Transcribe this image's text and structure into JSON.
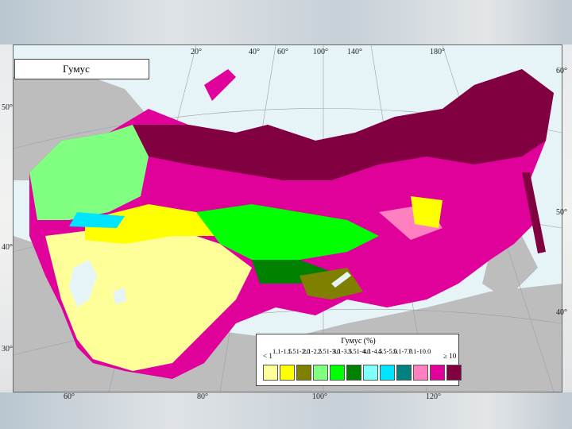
{
  "map": {
    "title": "Гумус",
    "top_ticks": [
      "20°",
      "40°",
      "60°",
      "100°",
      "140°",
      "180°"
    ],
    "bottom_ticks": [
      "60°",
      "80°",
      "100°",
      "120°"
    ],
    "left_ticks": [
      "50°",
      "40°",
      "30°"
    ],
    "right_ticks": [
      "60°",
      "50°",
      "40°"
    ]
  },
  "legend": {
    "title": "Гумус (%)",
    "low_label": "< 1",
    "high_label": "≥ 10",
    "classes": [
      {
        "label": "1.1-1.5",
        "color": "#ffff99"
      },
      {
        "label": "1.51-2.0",
        "color": "#ffff00"
      },
      {
        "label": "2.1-2.5",
        "color": "#808000"
      },
      {
        "label": "2.51-3.0",
        "color": "#80ff80"
      },
      {
        "label": "3.1-3.5",
        "color": "#00ff00"
      },
      {
        "label": "3.51-4.0",
        "color": "#008000"
      },
      {
        "label": "4.1-4.5",
        "color": "#80ffff"
      },
      {
        "label": "4.5-5.0",
        "color": "#00e5ff"
      },
      {
        "label": "5.1-7.0",
        "color": "#008080"
      },
      {
        "label": "7.1-10.0",
        "color": "#ff80c0"
      },
      {
        "label": "",
        "color": "#e0009a"
      },
      {
        "label": "",
        "color": "#800040"
      }
    ]
  },
  "colors": {
    "ocean": "#e6f4f8",
    "foreign_land": "#bdbdbd",
    "graticule": "#9aa0a6",
    "dominant_north": "#8b0045"
  }
}
